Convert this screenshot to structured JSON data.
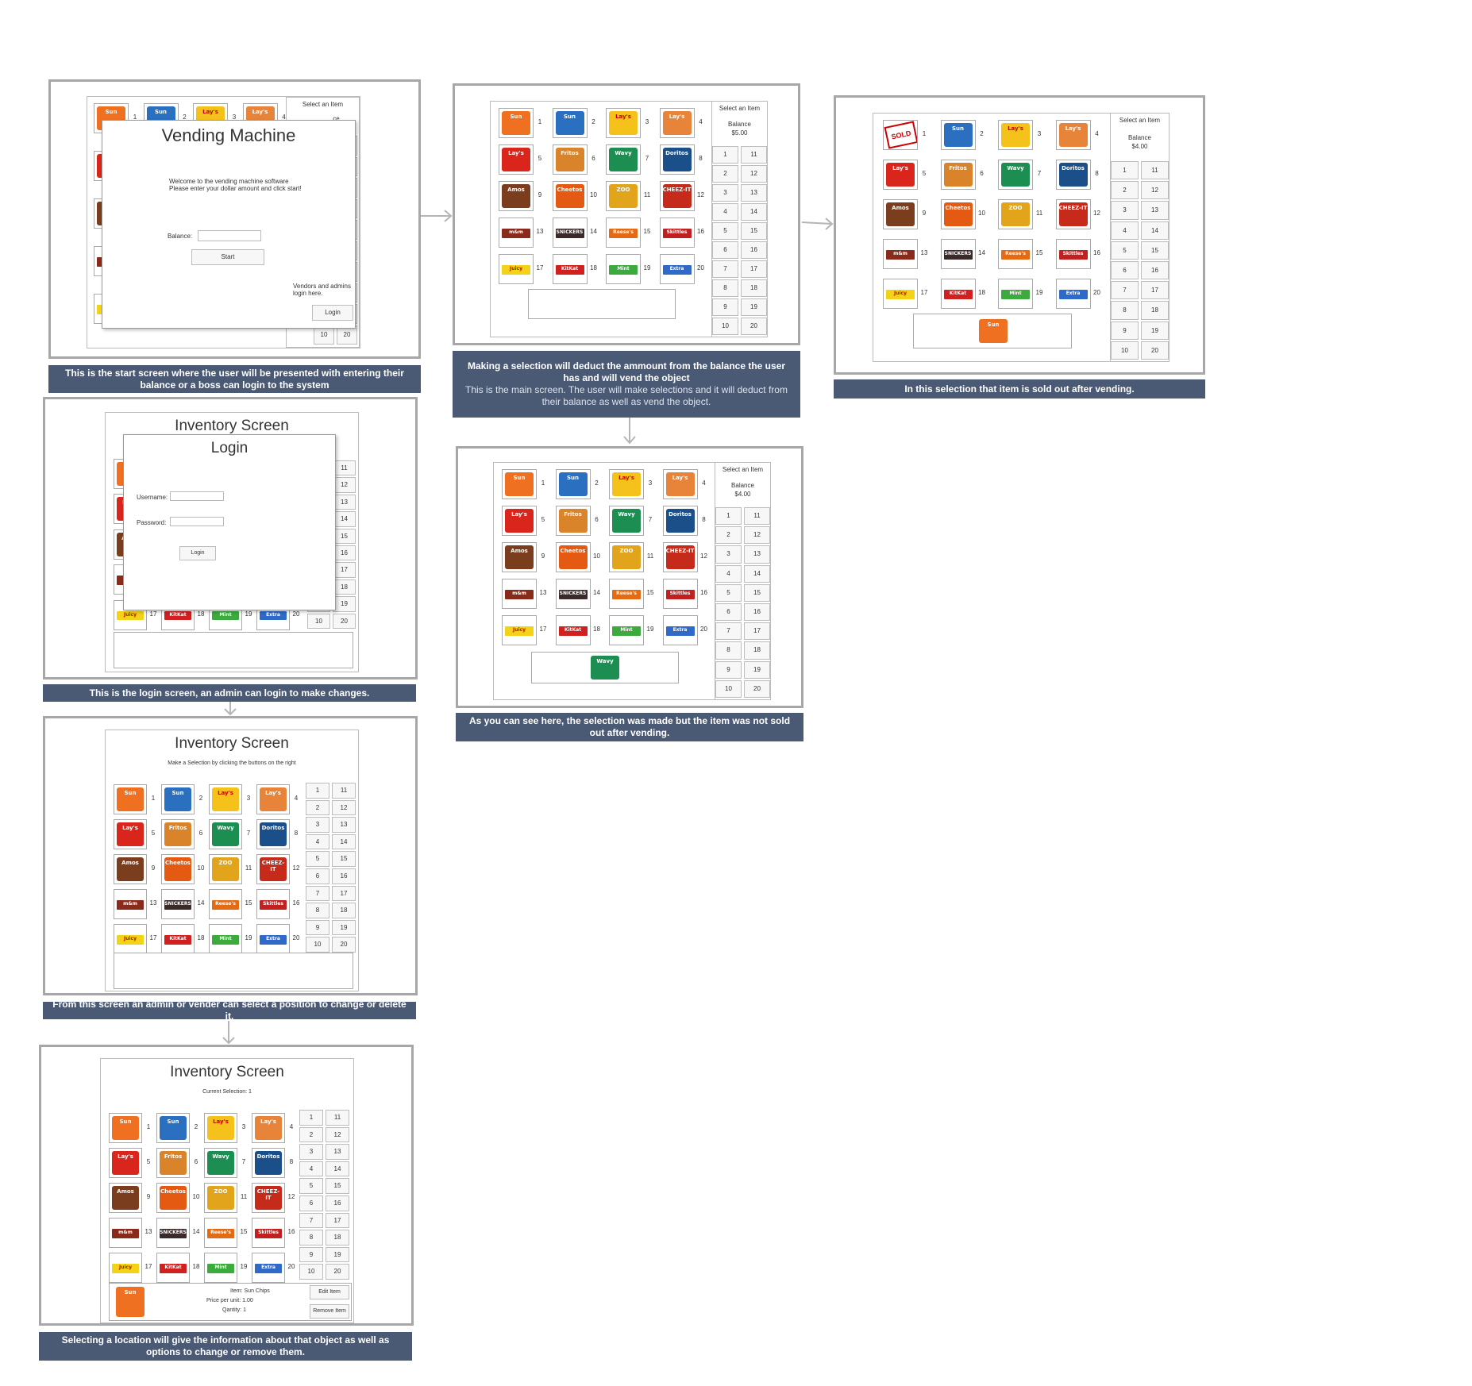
{
  "colors": {
    "caption_bg": "#4a5a75",
    "frame_border": "#a7a7a7",
    "arrow": "#b5b5b5"
  },
  "snacks": [
    {
      "name": "Sun Chips",
      "color": "#f07021",
      "label": "Sun",
      "bar": false
    },
    {
      "name": "Sun Chips Blue",
      "color": "#2a6fc0",
      "label": "Sun",
      "bar": false
    },
    {
      "name": "Lay's",
      "color": "#f4c21b",
      "label": "Lay's",
      "bar": false
    },
    {
      "name": "Lay's BBQ",
      "color": "#e8843a",
      "label": "Lay's",
      "bar": false
    },
    {
      "name": "Lay's Red",
      "color": "#d9251c",
      "label": "Lay's",
      "bar": false
    },
    {
      "name": "Fritos",
      "color": "#d9832a",
      "label": "Fritos",
      "bar": false
    },
    {
      "name": "Lay's Wavy",
      "color": "#1c8e52",
      "label": "Wavy",
      "bar": false
    },
    {
      "name": "Doritos",
      "color": "#1a4f8a",
      "label": "Doritos",
      "bar": false
    },
    {
      "name": "Famous Amos",
      "color": "#7a3d1d",
      "label": "Amos",
      "bar": false
    },
    {
      "name": "Cheetos",
      "color": "#e55a12",
      "label": "Cheetos",
      "bar": false
    },
    {
      "name": "Zoo",
      "color": "#e2a41a",
      "label": "ZOO",
      "bar": false
    },
    {
      "name": "Cheez-It",
      "color": "#c52a1a",
      "label": "CHEEZ-IT",
      "bar": false
    },
    {
      "name": "M&M's",
      "color": "#8a2a1a",
      "label": "m&m",
      "bar": true
    },
    {
      "name": "Snickers",
      "color": "#3a2a2a",
      "label": "SNICKERS",
      "bar": true
    },
    {
      "name": "Reese's",
      "color": "#e56a14",
      "label": "Reese's",
      "bar": true
    },
    {
      "name": "Skittles",
      "color": "#c22020",
      "label": "Skittles",
      "bar": true
    },
    {
      "name": "Juicy Fruit",
      "color": "#f2d317",
      "label": "Juicy",
      "bar": true
    },
    {
      "name": "Kit Kat",
      "color": "#d02020",
      "label": "KitKat",
      "bar": true
    },
    {
      "name": "Doublemint",
      "color": "#3caa3c",
      "label": "Mint",
      "bar": true
    },
    {
      "name": "Extra",
      "color": "#2f6ac9",
      "label": "Extra",
      "bar": true
    }
  ],
  "slot_numbers": [
    "1",
    "2",
    "3",
    "4",
    "5",
    "6",
    "7",
    "8",
    "9",
    "10",
    "11",
    "12",
    "13",
    "14",
    "15",
    "16",
    "17",
    "18",
    "19",
    "20"
  ],
  "left_buttons": [
    "1",
    "2",
    "3",
    "4",
    "5",
    "6",
    "7",
    "8",
    "9",
    "10"
  ],
  "right_buttons": [
    "11",
    "12",
    "13",
    "14",
    "15",
    "16",
    "17",
    "18",
    "19",
    "20"
  ],
  "frames": {
    "start": {
      "caption": "This is the start screen where the user will be presented with entering their balance or a boss can login to the system",
      "panel_header": "Select an Item",
      "panel_balance_fragment": "ce\n0",
      "dialog": {
        "title": "Vending Machine",
        "welcome": "Welcome to the vending machine software\nPlease enter your dollar amount and click start!",
        "balance_label": "Balance:",
        "start_button": "Start",
        "vendor_text": "Vendors and admins\nlogin here.",
        "login_button": "Login"
      },
      "visible_buttons": [
        "11",
        "12",
        "13",
        "14",
        "15",
        "16",
        "17",
        "18",
        "19",
        "20",
        "10",
        "20"
      ]
    },
    "main": {
      "caption_title": "Making a selection will deduct the ammount from the balance the user has and will vend the object",
      "caption_sub": "This is the main screen. The user will make selections and it will deduct from their balance as well as vend the object.",
      "panel_header": "Select an Item",
      "balance_label": "Balance",
      "balance_value": "$5.00"
    },
    "soldout": {
      "caption": "In this selection that item is sold out after vending.",
      "panel_header": "Select an Item",
      "balance_label": "Balance",
      "balance_value": "$4.00",
      "soldout_text": "SOLD OUT"
    },
    "notsold": {
      "caption": "As you can see here, the selection was made but the item was not sold out after vending.",
      "panel_header": "Select an Item",
      "balance_label": "Balance",
      "balance_value": "$4.00"
    },
    "login": {
      "caption": "This is the login screen, an admin can login to make changes.",
      "title": "Inventory Screen",
      "dialog_title": "Login",
      "username_label": "Username:",
      "password_label": "Password:",
      "login_button": "Login"
    },
    "inventory": {
      "caption": "From this screen an admin or vender can select a position to change or delete it.",
      "title": "Inventory Screen",
      "subtitle": "Make a Selection by clicking the buttons on the right"
    },
    "detail": {
      "caption": "Selecting a location will give the information about that object as well as options to change or remove them.",
      "title": "Inventory Screen",
      "subtitle": "Current Selection: 1",
      "item_label": "Item:  Sun Chips",
      "price_label": "Price per unit:  1.00",
      "qty_label": "Qantity:  1",
      "edit_button": "Edit Item",
      "remove_button": "Remove Item"
    }
  }
}
